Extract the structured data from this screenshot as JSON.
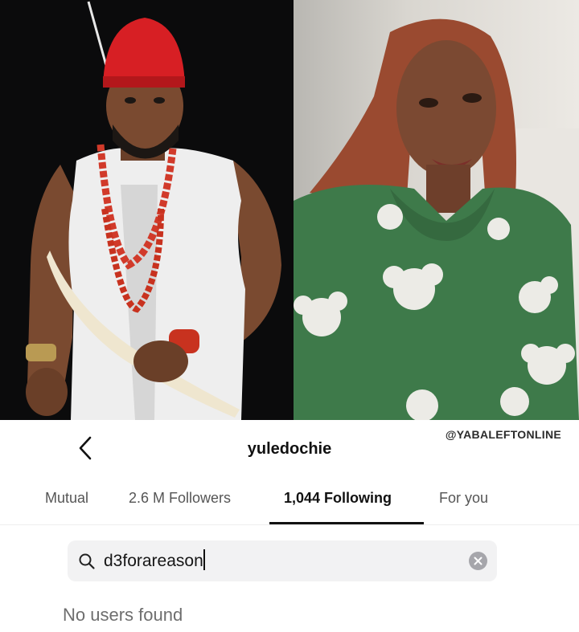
{
  "watermark": "@YABALEFTONLINE",
  "header": {
    "title": "yuledochie",
    "back_icon": "chevron-left-icon"
  },
  "tabs": [
    {
      "label": "Mutual",
      "active": false
    },
    {
      "label": "2.6 M Followers",
      "active": false
    },
    {
      "label": "1,044 Following",
      "active": true
    },
    {
      "label": "For you",
      "active": false
    }
  ],
  "search": {
    "value": "d3forareason",
    "icon": "search-icon",
    "clear_icon": "clear-icon"
  },
  "results": {
    "empty_text": "No users found"
  },
  "colors": {
    "accent": "#111111",
    "search_bg": "#f2f2f3",
    "muted_text": "#6e6e6e"
  }
}
